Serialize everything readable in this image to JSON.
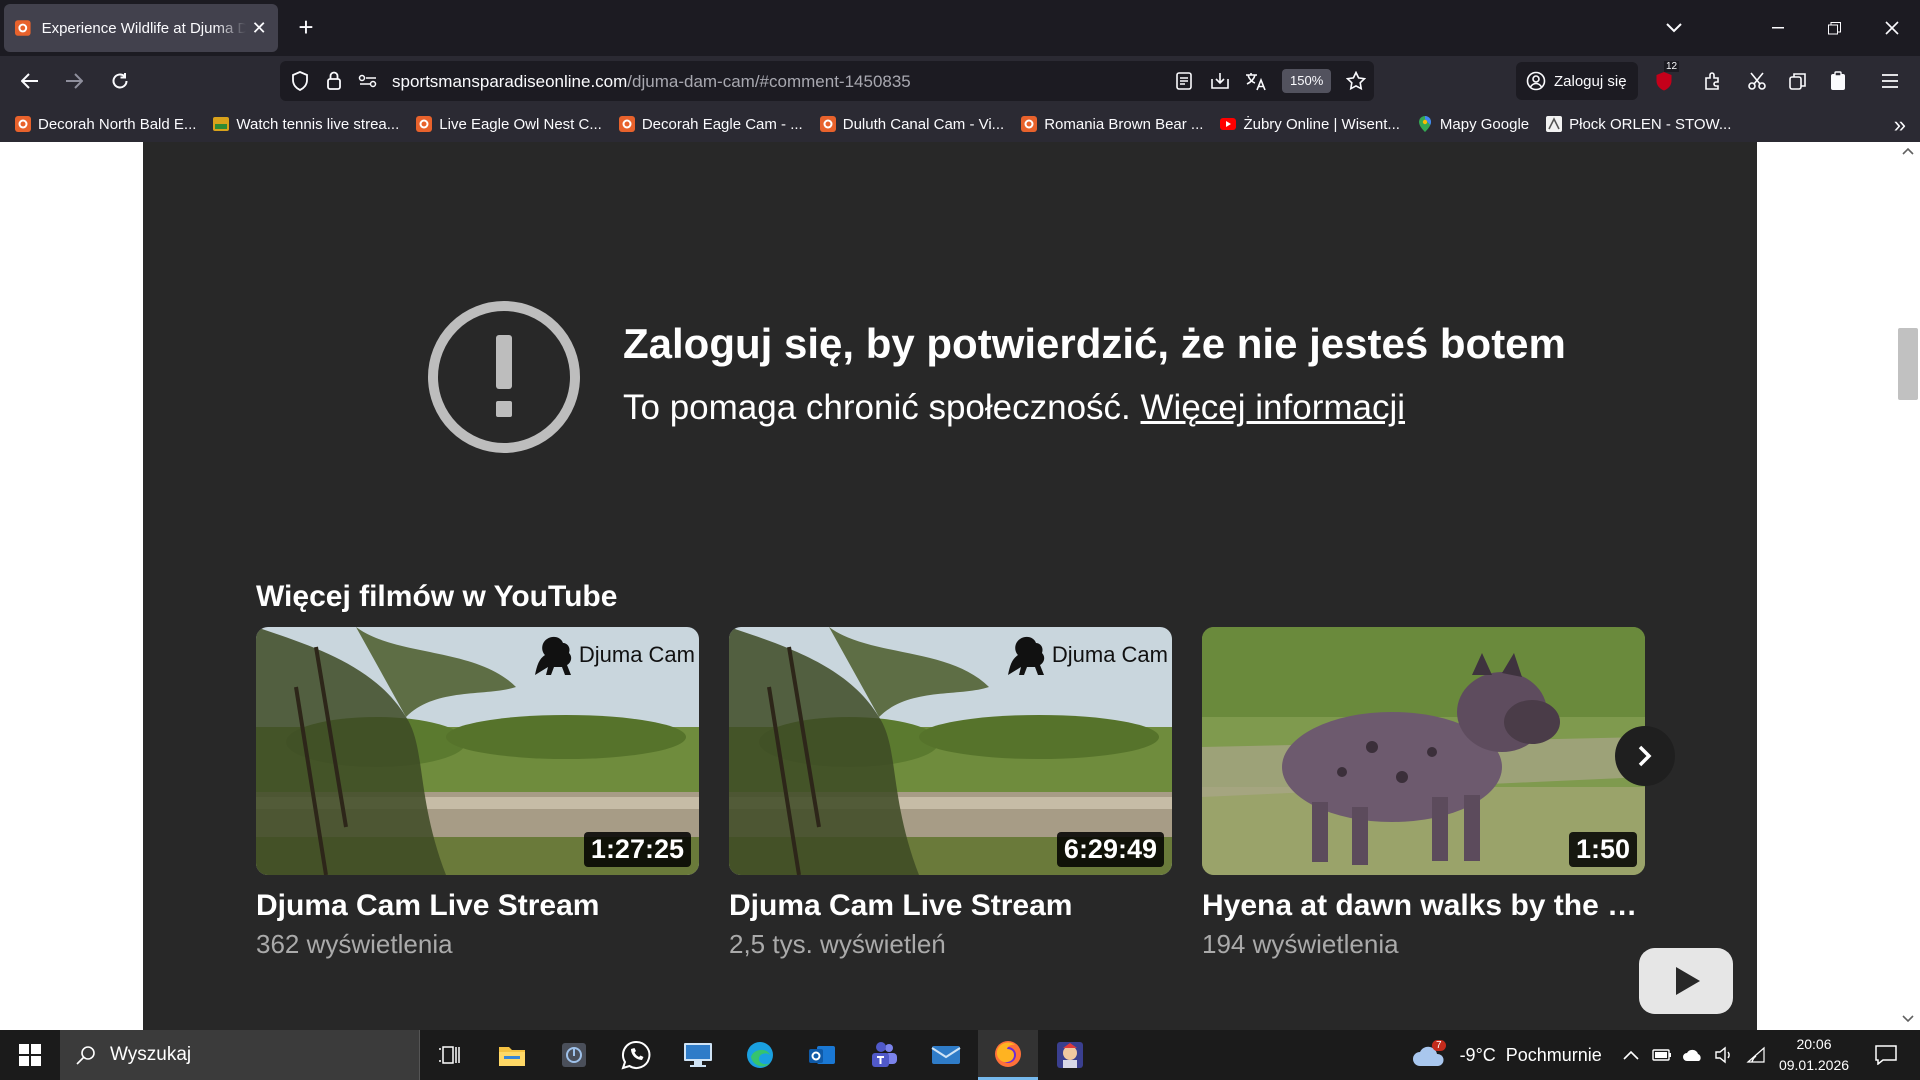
{
  "browser": {
    "tab": {
      "title": "Experience Wildlife at Djuma Dam Cam",
      "close": "✕"
    },
    "new_tab": "+",
    "url": {
      "domain": "sportsmansparadiseonline.com",
      "path": "/djuma-dam-cam/#comment-1450835"
    },
    "zoom": "150%",
    "signin_label": "Zaloguj się",
    "extension_badge": "12",
    "bookmarks": [
      {
        "label": "Decorah North Bald E...",
        "icon": "camera-favicon"
      },
      {
        "label": "Watch tennis live strea...",
        "icon": "tennis-favicon"
      },
      {
        "label": "Live Eagle Owl Nest C...",
        "icon": "camera-favicon"
      },
      {
        "label": "Decorah Eagle Cam - ...",
        "icon": "camera-favicon"
      },
      {
        "label": "Duluth Canal Cam - Vi...",
        "icon": "camera-favicon"
      },
      {
        "label": "Romania Brown Bear ...",
        "icon": "camera-favicon"
      },
      {
        "label": "Żubry Online | Wisent...",
        "icon": "youtube-favicon"
      },
      {
        "label": "Mapy Google",
        "icon": "maps-favicon"
      },
      {
        "label": "Płock ORLEN - STOW...",
        "icon": "orlen-favicon"
      }
    ]
  },
  "player": {
    "error_title": "Zaloguj się, by potwierdzić, że nie jesteś botem",
    "error_subtitle": "To pomaga chronić społeczność.",
    "error_link": "Więcej informacji",
    "more_title": "Więcej filmów w YouTube",
    "videos": [
      {
        "title": "Djuma Cam Live Stream",
        "views": "362 wyświetlenia",
        "duration": "1:27:25",
        "brand": "Djuma Cam"
      },
      {
        "title": "Djuma Cam Live Stream",
        "views": "2,5 tys. wyświetleń",
        "duration": "6:29:49",
        "brand": "Djuma Cam"
      },
      {
        "title": "Hyena at dawn walks by the Dj...",
        "views": "194 wyświetlenia",
        "duration": "1:50",
        "brand": ""
      }
    ]
  },
  "taskbar": {
    "search_placeholder": "Wyszukaj",
    "weather": {
      "temp": "-9°C",
      "condition": "Pochmurnie",
      "badge": "7"
    },
    "clock": {
      "time": "20:06",
      "date": "09.01.2026"
    }
  },
  "colors": {
    "player_bg": "#282828",
    "chrome_bg": "#1c1b22",
    "toolbar_bg": "#2b2a33",
    "taskbar_bg": "#1b1b1b"
  }
}
